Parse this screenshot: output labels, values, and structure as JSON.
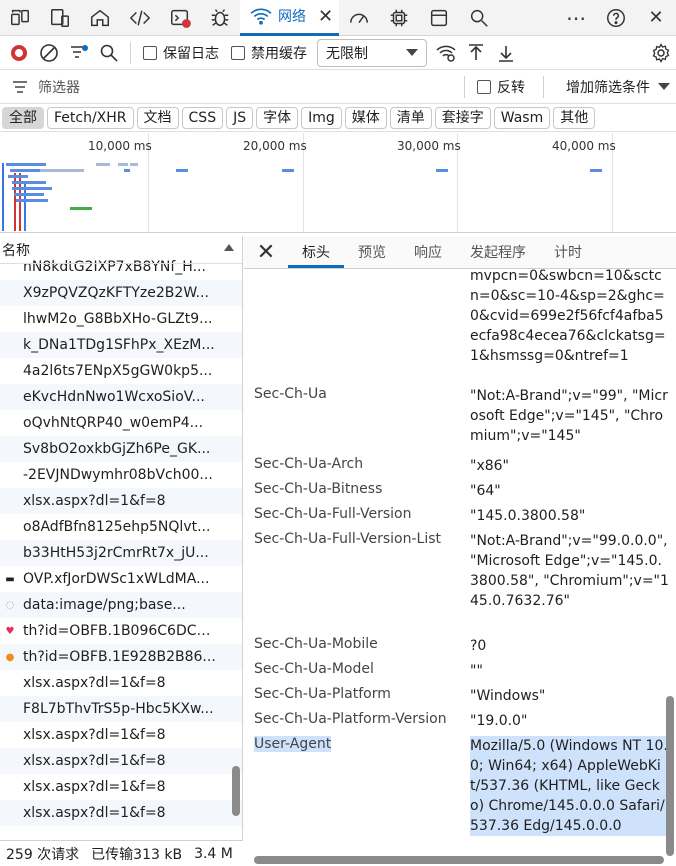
{
  "tabs": {
    "network_label": "网络"
  },
  "toolbar": {
    "preserve_log": "保留日志",
    "disable_cache": "禁用缓存",
    "throttle": "无限制"
  },
  "filter": {
    "placeholder": "筛选器",
    "invert": "反转",
    "more_filters": "增加筛选条件"
  },
  "chips": [
    "全部",
    "Fetch/XHR",
    "文档",
    "CSS",
    "JS",
    "字体",
    "Img",
    "媒体",
    "清单",
    "套接字",
    "Wasm",
    "其他"
  ],
  "overview": {
    "ticks": [
      "10,000 ms",
      "20,000 ms",
      "30,000 ms",
      "40,000 ms"
    ]
  },
  "name_column": {
    "header": "名称",
    "rows": [
      {
        "name": "nN8kdtG2IXP7xB8YNf_H...",
        "icon": "none"
      },
      {
        "name": "X9zPQVZQzKFTYze2B2W...",
        "icon": "none"
      },
      {
        "name": "lhwM2o_G8BbXHo-GLZt9...",
        "icon": "none"
      },
      {
        "name": "k_DNa1TDg1SFhPx_XEzM...",
        "icon": "none"
      },
      {
        "name": "4a2l6ts7ENpX5gGW0kp5...",
        "icon": "none"
      },
      {
        "name": "eKvcHdnNwo1WcxoSioV...",
        "icon": "none"
      },
      {
        "name": "oQvhNtQRP40_w0emP4...",
        "icon": "none"
      },
      {
        "name": "Sv8bO2oxkbGjZh6Pe_GK...",
        "icon": "none"
      },
      {
        "name": "-2EVJNDwymhr08bVch00...",
        "icon": "none"
      },
      {
        "name": "xlsx.aspx?dl=1&f=8",
        "icon": "none"
      },
      {
        "name": "o8AdfBfn8125ehp5NQlvt...",
        "icon": "none"
      },
      {
        "name": "b33HtH53j2rCmrRt7x_jU...",
        "icon": "none"
      },
      {
        "name": "OVP.xfJorDWSc1xWLdMA...",
        "icon": "image"
      },
      {
        "name": "data:image/png;base...",
        "icon": "drop"
      },
      {
        "name": "th?id=OBFB.1B096C6DCB...",
        "icon": "heart"
      },
      {
        "name": "th?id=OBFB.1E928B2B86...",
        "icon": "face"
      },
      {
        "name": "xlsx.aspx?dl=1&f=8",
        "icon": "none"
      },
      {
        "name": "F8L7bThvTrS5p-Hbc5KXw...",
        "icon": "none"
      },
      {
        "name": "xlsx.aspx?dl=1&f=8",
        "icon": "none"
      },
      {
        "name": "xlsx.aspx?dl=1&f=8",
        "icon": "none"
      },
      {
        "name": "xlsx.aspx?dl=1&f=8",
        "icon": "none"
      },
      {
        "name": "xlsx.aspx?dl=1&f=8",
        "icon": "none"
      }
    ]
  },
  "status": {
    "requests": "259 次请求",
    "transferred": "已传输313 kB",
    "resources": "3.4 M"
  },
  "details": {
    "tabs": [
      "标头",
      "预览",
      "响应",
      "发起程序",
      "计时"
    ],
    "active_tab": "标头",
    "headers": [
      {
        "key": "",
        "value": "mvpcn=0&swbcn=10&sctcn=0&sc=10-4&sp=2&ghc=0&cvid=699e2f56fcf4afba5ecfa98c4ecea76&clckatsg=1&hsmssg=0&ntref=1"
      },
      {
        "key": "Sec-Ch-Ua",
        "value": "\"Not:A-Brand\";v=\"99\", \"Microsoft Edge\";v=\"145\", \"Chromium\";v=\"145\""
      },
      {
        "key": "Sec-Ch-Ua-Arch",
        "value": "\"x86\""
      },
      {
        "key": "Sec-Ch-Ua-Bitness",
        "value": "\"64\""
      },
      {
        "key": "Sec-Ch-Ua-Full-Version",
        "value": "\"145.0.3800.58\""
      },
      {
        "key": "Sec-Ch-Ua-Full-Version-List",
        "value": "\"Not:A-Brand\";v=\"99.0.0.0\", \"Microsoft Edge\";v=\"145.0.3800.58\", \"Chromium\";v=\"145.0.7632.76\""
      },
      {
        "key": "Sec-Ch-Ua-Mobile",
        "value": "?0"
      },
      {
        "key": "Sec-Ch-Ua-Model",
        "value": "\"\""
      },
      {
        "key": "Sec-Ch-Ua-Platform",
        "value": "\"Windows\""
      },
      {
        "key": "Sec-Ch-Ua-Platform-Version",
        "value": "\"19.0.0\""
      },
      {
        "key": "User-Agent",
        "value": "Mozilla/5.0 (Windows NT 10.0; Win64; x64) AppleWebKit/537.36 (KHTML, like Gecko) Chrome/145.0.0.0 Safari/537.36 Edg/145.0.0.0"
      }
    ]
  },
  "colors": {
    "accent": "#0f6cbd",
    "record_red": "#d13438",
    "selection": "#cfe2fb"
  }
}
